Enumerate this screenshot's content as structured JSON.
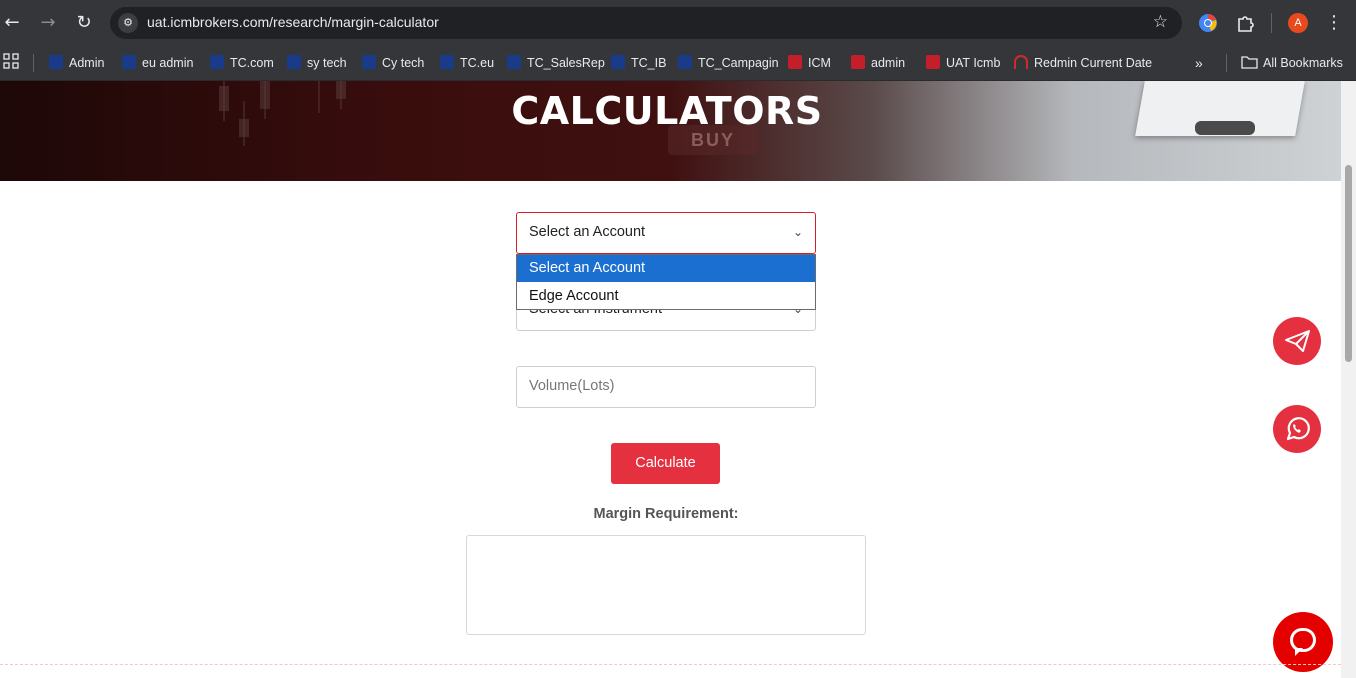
{
  "browser": {
    "url": "uat.icmbrokers.com/research/margin-calculator",
    "profile_initial": "A",
    "all_bookmarks_label": "All Bookmarks"
  },
  "bookmarks": [
    {
      "label": "Admin",
      "icon": "tc-icon"
    },
    {
      "label": "eu admin",
      "icon": "tc-icon"
    },
    {
      "label": "TC.com",
      "icon": "tc-icon"
    },
    {
      "label": "sy tech",
      "icon": "tc-icon"
    },
    {
      "label": "Cy tech",
      "icon": "tc-icon"
    },
    {
      "label": "TC.eu",
      "icon": "tc-icon"
    },
    {
      "label": "TC_SalesRep",
      "icon": "tc-icon"
    },
    {
      "label": "TC_IB",
      "icon": "tc-icon"
    },
    {
      "label": "TC_Campagin",
      "icon": "tc-icon"
    },
    {
      "label": "ICM",
      "icon": "icm-icon"
    },
    {
      "label": "admin",
      "icon": "icm-icon"
    },
    {
      "label": "UAT Icmb",
      "icon": "icm-icon"
    },
    {
      "label": "Redmin Current Date",
      "icon": "redmine-icon"
    }
  ],
  "hero": {
    "title": "CALCULATORS",
    "buy_text": "BUY"
  },
  "form": {
    "account_select_value": "Select an Account",
    "account_options": [
      "Select an Account",
      "Edge Account"
    ],
    "instrument_select_value": "Select an Instrument",
    "volume_placeholder": "Volume(Lots)",
    "calculate_label": "Calculate",
    "margin_label": "Margin Requirement:"
  },
  "colors": {
    "accent": "#e5303f",
    "selected_option": "#1a6fd1"
  }
}
